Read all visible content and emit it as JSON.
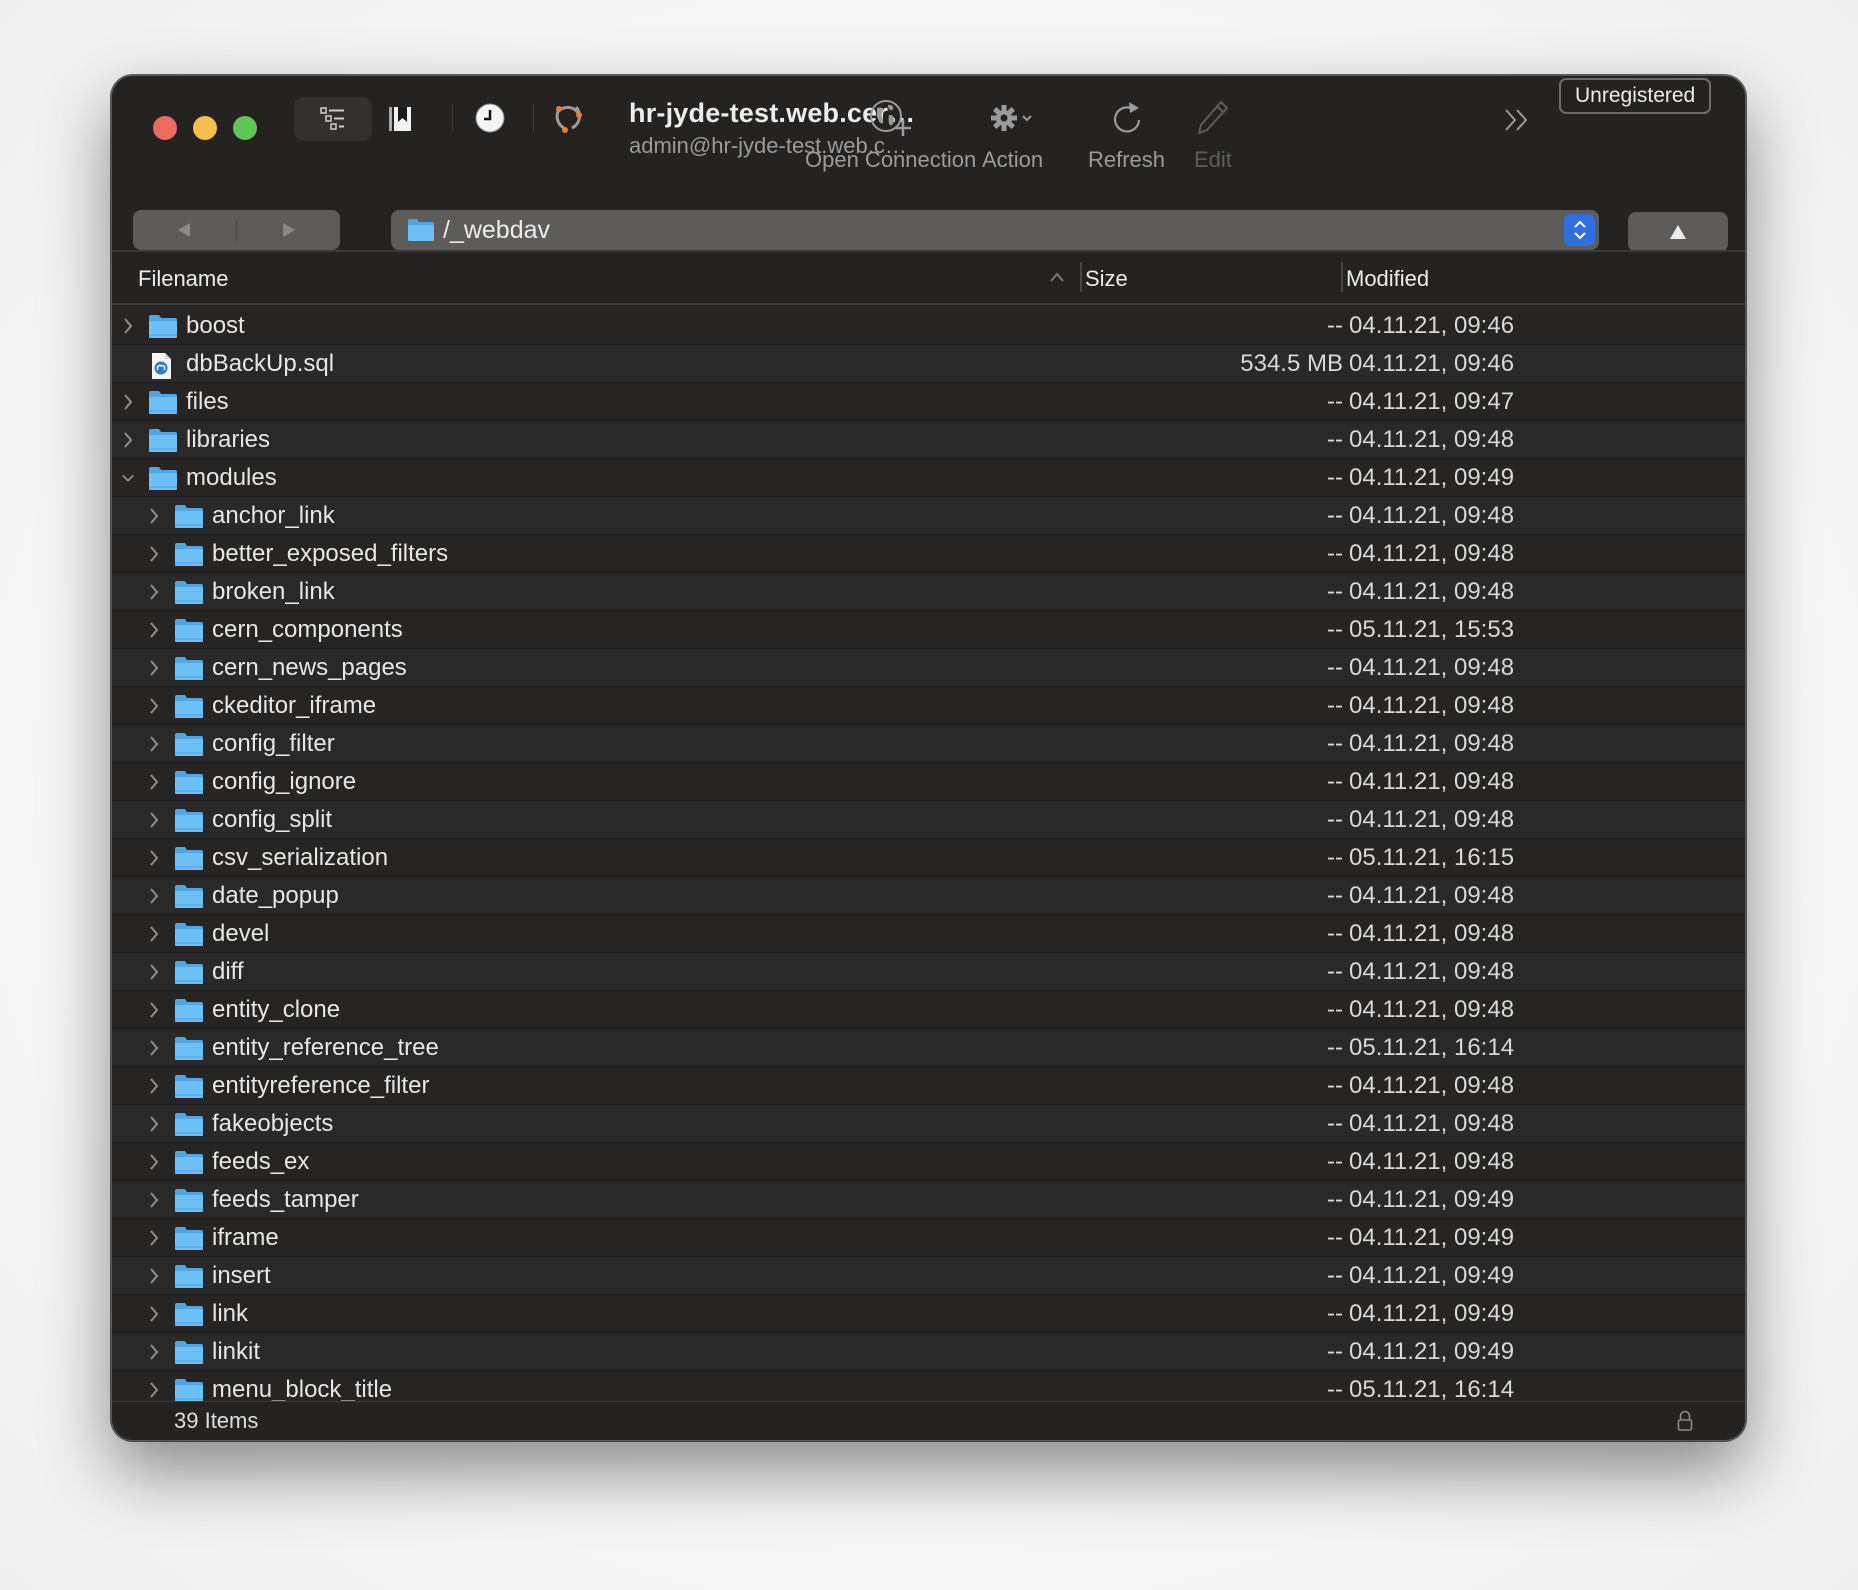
{
  "window": {
    "title": "hr-jyde-test.web.cer…",
    "subtitle": "admin@hr-jyde-test.web.c…",
    "badge": "Unregistered"
  },
  "toolbar": {
    "left_icons": [
      "sidebar-outline-icon",
      "bookmarks-icon",
      "history-clock-icon",
      "bonjour-icon"
    ],
    "tools": [
      {
        "label": "Open Connection",
        "icon": "globe-plus-icon",
        "enabled": true
      },
      {
        "label": "Action",
        "icon": "gear-icon",
        "enabled": true
      },
      {
        "label": "Refresh",
        "icon": "refresh-icon",
        "enabled": true
      },
      {
        "label": "Edit",
        "icon": "pencil-icon",
        "enabled": false
      }
    ],
    "overflow_icon": "chevrons-right-icon"
  },
  "navbar": {
    "back_icon": "triangle-left-icon",
    "forward_icon": "triangle-right-icon",
    "path": "/_webdav",
    "up_icon": "triangle-up-icon"
  },
  "columns": {
    "filename": "Filename",
    "size": "Size",
    "modified": "Modified",
    "sort": "ascending"
  },
  "rows": [
    {
      "name": "boost",
      "type": "folder",
      "level": 0,
      "expanded": false,
      "size": "--",
      "modified": "04.11.21, 09:46"
    },
    {
      "name": "dbBackUp.sql",
      "type": "file",
      "level": 0,
      "expanded": null,
      "size": "534.5 MB",
      "modified": "04.11.21, 09:46"
    },
    {
      "name": "files",
      "type": "folder",
      "level": 0,
      "expanded": false,
      "size": "--",
      "modified": "04.11.21, 09:47"
    },
    {
      "name": "libraries",
      "type": "folder",
      "level": 0,
      "expanded": false,
      "size": "--",
      "modified": "04.11.21, 09:48"
    },
    {
      "name": "modules",
      "type": "folder",
      "level": 0,
      "expanded": true,
      "size": "--",
      "modified": "04.11.21, 09:49"
    },
    {
      "name": "anchor_link",
      "type": "folder",
      "level": 1,
      "expanded": false,
      "size": "--",
      "modified": "04.11.21, 09:48"
    },
    {
      "name": "better_exposed_filters",
      "type": "folder",
      "level": 1,
      "expanded": false,
      "size": "--",
      "modified": "04.11.21, 09:48"
    },
    {
      "name": "broken_link",
      "type": "folder",
      "level": 1,
      "expanded": false,
      "size": "--",
      "modified": "04.11.21, 09:48"
    },
    {
      "name": "cern_components",
      "type": "folder",
      "level": 1,
      "expanded": false,
      "size": "--",
      "modified": "05.11.21, 15:53"
    },
    {
      "name": "cern_news_pages",
      "type": "folder",
      "level": 1,
      "expanded": false,
      "size": "--",
      "modified": "04.11.21, 09:48"
    },
    {
      "name": "ckeditor_iframe",
      "type": "folder",
      "level": 1,
      "expanded": false,
      "size": "--",
      "modified": "04.11.21, 09:48"
    },
    {
      "name": "config_filter",
      "type": "folder",
      "level": 1,
      "expanded": false,
      "size": "--",
      "modified": "04.11.21, 09:48"
    },
    {
      "name": "config_ignore",
      "type": "folder",
      "level": 1,
      "expanded": false,
      "size": "--",
      "modified": "04.11.21, 09:48"
    },
    {
      "name": "config_split",
      "type": "folder",
      "level": 1,
      "expanded": false,
      "size": "--",
      "modified": "04.11.21, 09:48"
    },
    {
      "name": "csv_serialization",
      "type": "folder",
      "level": 1,
      "expanded": false,
      "size": "--",
      "modified": "05.11.21, 16:15"
    },
    {
      "name": "date_popup",
      "type": "folder",
      "level": 1,
      "expanded": false,
      "size": "--",
      "modified": "04.11.21, 09:48"
    },
    {
      "name": "devel",
      "type": "folder",
      "level": 1,
      "expanded": false,
      "size": "--",
      "modified": "04.11.21, 09:48"
    },
    {
      "name": "diff",
      "type": "folder",
      "level": 1,
      "expanded": false,
      "size": "--",
      "modified": "04.11.21, 09:48"
    },
    {
      "name": "entity_clone",
      "type": "folder",
      "level": 1,
      "expanded": false,
      "size": "--",
      "modified": "04.11.21, 09:48"
    },
    {
      "name": "entity_reference_tree",
      "type": "folder",
      "level": 1,
      "expanded": false,
      "size": "--",
      "modified": "05.11.21, 16:14"
    },
    {
      "name": "entityreference_filter",
      "type": "folder",
      "level": 1,
      "expanded": false,
      "size": "--",
      "modified": "04.11.21, 09:48"
    },
    {
      "name": "fakeobjects",
      "type": "folder",
      "level": 1,
      "expanded": false,
      "size": "--",
      "modified": "04.11.21, 09:48"
    },
    {
      "name": "feeds_ex",
      "type": "folder",
      "level": 1,
      "expanded": false,
      "size": "--",
      "modified": "04.11.21, 09:48"
    },
    {
      "name": "feeds_tamper",
      "type": "folder",
      "level": 1,
      "expanded": false,
      "size": "--",
      "modified": "04.11.21, 09:49"
    },
    {
      "name": "iframe",
      "type": "folder",
      "level": 1,
      "expanded": false,
      "size": "--",
      "modified": "04.11.21, 09:49"
    },
    {
      "name": "insert",
      "type": "folder",
      "level": 1,
      "expanded": false,
      "size": "--",
      "modified": "04.11.21, 09:49"
    },
    {
      "name": "link",
      "type": "folder",
      "level": 1,
      "expanded": false,
      "size": "--",
      "modified": "04.11.21, 09:49"
    },
    {
      "name": "linkit",
      "type": "folder",
      "level": 1,
      "expanded": false,
      "size": "--",
      "modified": "04.11.21, 09:49"
    },
    {
      "name": "menu_block_title",
      "type": "folder",
      "level": 1,
      "expanded": false,
      "size": "--",
      "modified": "05.11.21, 16:14"
    }
  ],
  "status": {
    "item_count": "39 Items",
    "lock_icon": "lock-icon"
  },
  "colors": {
    "window_bg": "#242322",
    "folder_blue": "#5ab4f0",
    "accent_blue": "#2f6fe0",
    "close": "#ec6a5e",
    "minimize": "#f4bf4f",
    "maximize": "#61c554"
  }
}
